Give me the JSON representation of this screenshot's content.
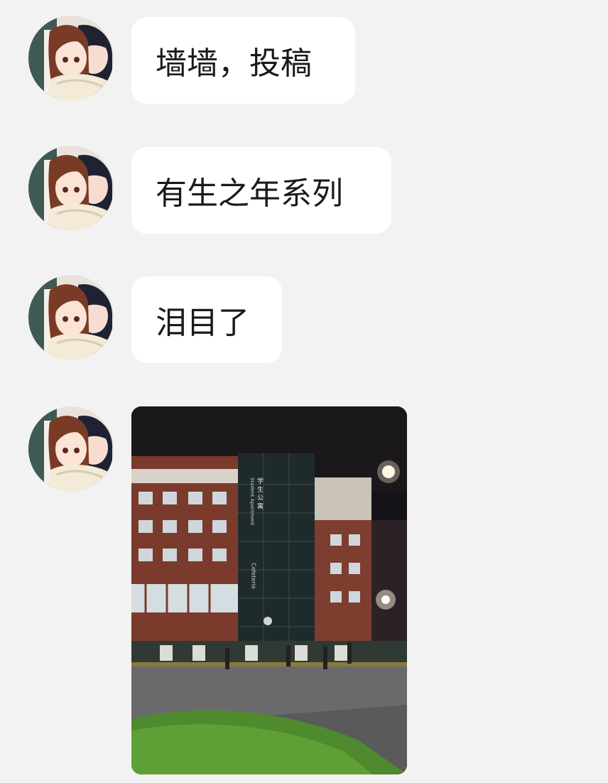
{
  "messages": [
    {
      "type": "text",
      "text": "墙墙，投稿",
      "avatar_icon": "anime-couple-avatar-icon"
    },
    {
      "type": "text",
      "text": "有生之年系列",
      "avatar_icon": "anime-couple-avatar-icon"
    },
    {
      "type": "text",
      "text": "泪目了",
      "avatar_icon": "anime-couple-avatar-icon"
    },
    {
      "type": "image",
      "avatar_icon": "anime-couple-avatar-icon",
      "image_icon": "night-building-photo"
    }
  ],
  "photo": {
    "building_sign_cn": "学 生 公 寓",
    "building_sign_en": "Student Apartment",
    "building_sign_cafeteria": "Cafeteria"
  },
  "colors": {
    "background": "#f2f2f2",
    "bubble": "#ffffff",
    "text": "#1a1a1a"
  }
}
